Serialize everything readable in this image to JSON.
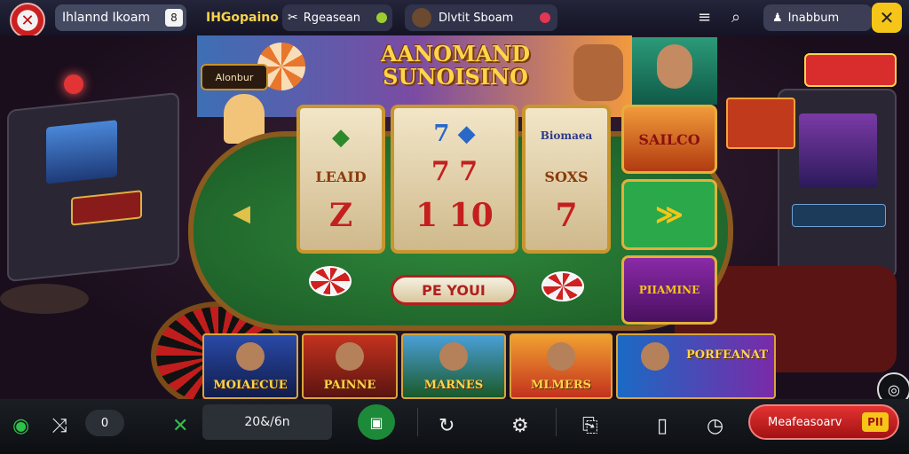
{
  "topbar": {
    "logo_icon": "✕",
    "tab1_label": "Ihlannd Ikoam",
    "tab1_badge": "8",
    "tab2_label": "IHGopaino",
    "tab3_label": "Rgeasean",
    "tab4_label": "Dlvtit Sboam",
    "menu_icon": "≡",
    "search_icon": "⌕",
    "profile_label": "Inabbum",
    "close_icon": "✕"
  },
  "stage": {
    "title": "AANOMAND SUNOISINO",
    "sign_text": "Alonbur",
    "reels": [
      {
        "top": "◆",
        "middle": "LEAID",
        "bottom": "Z"
      },
      {
        "top": "7 ◆",
        "middle": "7 7",
        "bottom": "1 10"
      },
      {
        "top": "Biomaea",
        "middle": "SOXS",
        "bottom": "7"
      }
    ],
    "spin_label": "PE YOUI",
    "side_cards": [
      "SAILCO",
      "≫",
      "PIIAMINE"
    ],
    "game_tiles": [
      "MOIAECUE",
      "PAINNE",
      "MARNES",
      "MLMERS",
      "PORFEANAT"
    ]
  },
  "bottombar": {
    "count_value": "0",
    "bet_value": "20&/6n",
    "play_icon": "▣",
    "cta_label": "Meafeasoarv",
    "cta_badge": "PII"
  },
  "colors": {
    "accent": "#f5c518",
    "table": "#2f8a3c",
    "cta": "#d62626"
  }
}
